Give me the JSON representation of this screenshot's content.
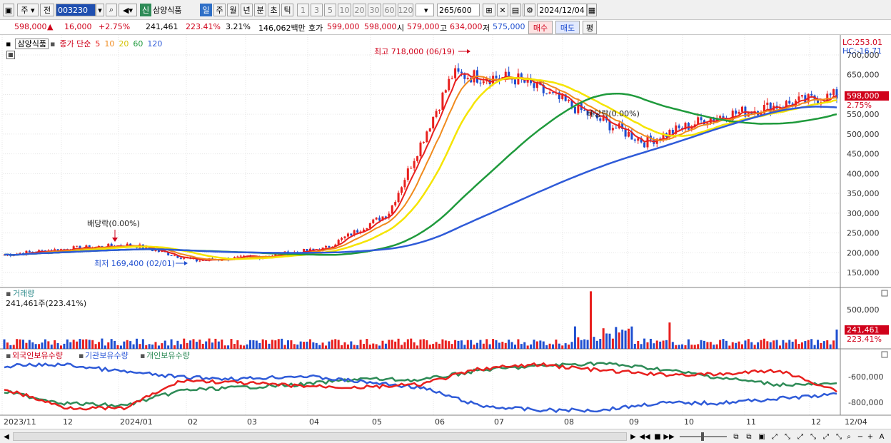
{
  "toolbar": {
    "market": "주",
    "prefix": "전",
    "code": "003230",
    "new_badge": "신",
    "stock_name": "삼양식품",
    "periods": [
      "일",
      "주",
      "월",
      "년",
      "분",
      "초",
      "틱"
    ],
    "numbers": [
      "1",
      "3",
      "5",
      "10",
      "20",
      "30",
      "60",
      "120"
    ],
    "count": "265",
    "count_total": "/600",
    "date": "2024/12/04"
  },
  "info": {
    "price": "598,000",
    "arrow": "▲",
    "change": "16,000",
    "change_pct": "+2.75%",
    "volume": "241,461",
    "volume_pct": "223.41%",
    "turnover_pct": "3.21%",
    "amount": "146,062백만",
    "quote_label": "호가",
    "ask": "599,000",
    "bid": "598,000",
    "open_label": "시",
    "open": "579,000",
    "high_label": "고",
    "high": "634,000",
    "low_label": "저",
    "low": "575,000",
    "buy_btn": "매수",
    "sell_btn": "매도",
    "eval_btn": "평"
  },
  "price_pane": {
    "name": "삼양식품",
    "ma_label": "종가 단순",
    "ma_periods": [
      "5",
      "10",
      "20",
      "60",
      "120"
    ],
    "lc": "LC:253.01",
    "hc": "HC:-16.71",
    "current_tag": "598,000",
    "current_pct": "2.75%",
    "high_annot": "최고 718,000 (06/19)",
    "low_annot": "최저 169,400 (02/01)",
    "div1": "배당락(0.00%)",
    "div2": "배당락(0.00%)",
    "y_ticks": [
      "700,000",
      "650,000",
      "600,000",
      "550,000",
      "500,000",
      "450,000",
      "400,000",
      "350,000",
      "300,000",
      "250,000",
      "200,000",
      "150,000"
    ]
  },
  "volume_pane": {
    "title": "거래량",
    "value_label": "241,461주(223.41%)",
    "y_tick": "500,000",
    "tag_value": "241,461",
    "tag_pct": "223.41%"
  },
  "holding_pane": {
    "series": [
      "외국인보유수량",
      "기관보유수량",
      "개인보유수량"
    ],
    "y_ticks": [
      "-600,000",
      "-800,000"
    ]
  },
  "x_axis": [
    "2023/11",
    "12",
    "2024/01",
    "02",
    "03",
    "04",
    "05",
    "06",
    "07",
    "08",
    "09",
    "10",
    "11",
    "12",
    "12/04"
  ],
  "colors": {
    "ma5": "#e8201e",
    "ma10": "#f08a1c",
    "ma20": "#f5e400",
    "ma60": "#1f9a3c",
    "ma120": "#2f5bd8",
    "up": "#e8201e",
    "down": "#1f4fd0",
    "foreign": "#e8201e",
    "inst": "#2f5bd8",
    "indiv": "#2e8b57"
  },
  "chart_data": {
    "type": "line",
    "x": [
      "2023/11",
      "2023/12",
      "2024/01",
      "2024/02",
      "2024/03",
      "2024/04",
      "2024/05",
      "2024/06",
      "2024/07",
      "2024/08",
      "2024/09",
      "2024/10",
      "2024/11",
      "2024/12"
    ],
    "series": [
      {
        "name": "종가",
        "values": [
          195000,
          210000,
          220000,
          180000,
          190000,
          210000,
          300000,
          650000,
          640000,
          560000,
          480000,
          540000,
          570000,
          598000
        ]
      },
      {
        "name": "60",
        "values": [
          180000,
          190000,
          195000,
          195000,
          192000,
          195000,
          220000,
          340000,
          500000,
          600000,
          590000,
          545000,
          530000,
          535000
        ]
      },
      {
        "name": "120",
        "values": [
          150000,
          165000,
          178000,
          190000,
          192000,
          195000,
          205000,
          255000,
          330000,
          400000,
          460000,
          510000,
          555000,
          570000
        ]
      }
    ],
    "ylim": [
      125000,
      725000
    ]
  }
}
